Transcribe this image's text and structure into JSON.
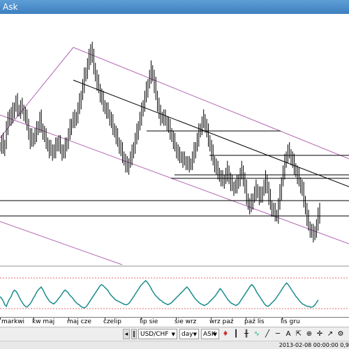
{
  "window": {
    "title": "Ask"
  },
  "chart": {
    "price_series": [
      58,
      60,
      57,
      59,
      66,
      69,
      72,
      70,
      73,
      75,
      77,
      74,
      73,
      75,
      74,
      72,
      70,
      68,
      63,
      60,
      62,
      61,
      63,
      65,
      67,
      70,
      66,
      64,
      62,
      60,
      58,
      56,
      57,
      55,
      56,
      58,
      60,
      59,
      57,
      55,
      56,
      58,
      60,
      63,
      66,
      68,
      70,
      69,
      71,
      74,
      77,
      80,
      84,
      88,
      90,
      93,
      96,
      100,
      96,
      92,
      88,
      85,
      83,
      80,
      78,
      76,
      74,
      73,
      72,
      70,
      68,
      66,
      64,
      62,
      60,
      58,
      56,
      54,
      52,
      50,
      49,
      51,
      53,
      55,
      58,
      61,
      64,
      67,
      70,
      73,
      76,
      79,
      82,
      85,
      88,
      91,
      88,
      84,
      80,
      76,
      72,
      70,
      71,
      70,
      69,
      68,
      66,
      64,
      62,
      60,
      58,
      56,
      54,
      54,
      53,
      52,
      52,
      51,
      50,
      50,
      51,
      53,
      56,
      58,
      61,
      64,
      66,
      68,
      70,
      67,
      64,
      61,
      58,
      55,
      52,
      50,
      48,
      47,
      45,
      44,
      43,
      44,
      46,
      48,
      44,
      42,
      41,
      40,
      41,
      42,
      44,
      46,
      48,
      44,
      40,
      36,
      33,
      32,
      34,
      36,
      38,
      40,
      38,
      36,
      37,
      39,
      41,
      44,
      40,
      36,
      33,
      31,
      30,
      29,
      28,
      33,
      38,
      43,
      47,
      51,
      54,
      56,
      55,
      53,
      51,
      49,
      47,
      45,
      43,
      41,
      39,
      35,
      31,
      27,
      24,
      22,
      21,
      20,
      22,
      24,
      28,
      32
    ],
    "channels": [
      {
        "name": "channel-upper",
        "color": "#b266b2"
      },
      {
        "name": "channel-lower",
        "color": "#b266b2"
      },
      {
        "name": "channel-mid",
        "color": "#000000"
      }
    ],
    "line_color": "#000000",
    "level_color": "#000000"
  },
  "oscillator": {
    "series": [
      40,
      38,
      35,
      30,
      28,
      33,
      37,
      40,
      45,
      48,
      47,
      44,
      40,
      36,
      33,
      30,
      28,
      27,
      29,
      31,
      34,
      38,
      41,
      45,
      48,
      50,
      52,
      49,
      45,
      41,
      38,
      35,
      33,
      32,
      31,
      33,
      35,
      38,
      40,
      43,
      46,
      48,
      47,
      45,
      42,
      40,
      38,
      35,
      33,
      31,
      30,
      28,
      27,
      26,
      27,
      29,
      32,
      35,
      38,
      41,
      44,
      47,
      50,
      53,
      55,
      54,
      52,
      50,
      48,
      45,
      42,
      40,
      38,
      36,
      35,
      34,
      33,
      32,
      31,
      30,
      30,
      31,
      33,
      36,
      39,
      42,
      45,
      48,
      51,
      54,
      56,
      58,
      60,
      58,
      55,
      52,
      48,
      45,
      42,
      40,
      38,
      36,
      35,
      33,
      32,
      31,
      30,
      31,
      32,
      34,
      36,
      38,
      40,
      42,
      44,
      46,
      48,
      50,
      52,
      50,
      47,
      44,
      41,
      38,
      36,
      34,
      32,
      31,
      30,
      29,
      30,
      31,
      33,
      35,
      37,
      39,
      41,
      44,
      47,
      50,
      48,
      45,
      42,
      39,
      36,
      34,
      32,
      31,
      30,
      29,
      30,
      32,
      35,
      38,
      41,
      44,
      47,
      50,
      53,
      55,
      53,
      50,
      46,
      43,
      40,
      37,
      34,
      31,
      29,
      28,
      29,
      31,
      33,
      35,
      37,
      40,
      43,
      46,
      49,
      52,
      55,
      57,
      55,
      52,
      49,
      46,
      43,
      40,
      38,
      35,
      33,
      31,
      30,
      29,
      28,
      28,
      27,
      27,
      28,
      30,
      33,
      36
    ],
    "line_color": "#1a8c8c",
    "band_color": "#e06a6a"
  },
  "xaxis": {
    "labels": [
      "markwi",
      "kw maj",
      "maj cze",
      "czelip",
      "lip sie",
      "sie wrz",
      "wrz paź",
      "paź lis",
      "lis gru"
    ]
  },
  "toolbar": {
    "symbol": "USD/CHF",
    "timeframe": "day",
    "price_type": "ASK"
  },
  "status": {
    "text": "2013-02-08 00:00:00  0,9"
  }
}
